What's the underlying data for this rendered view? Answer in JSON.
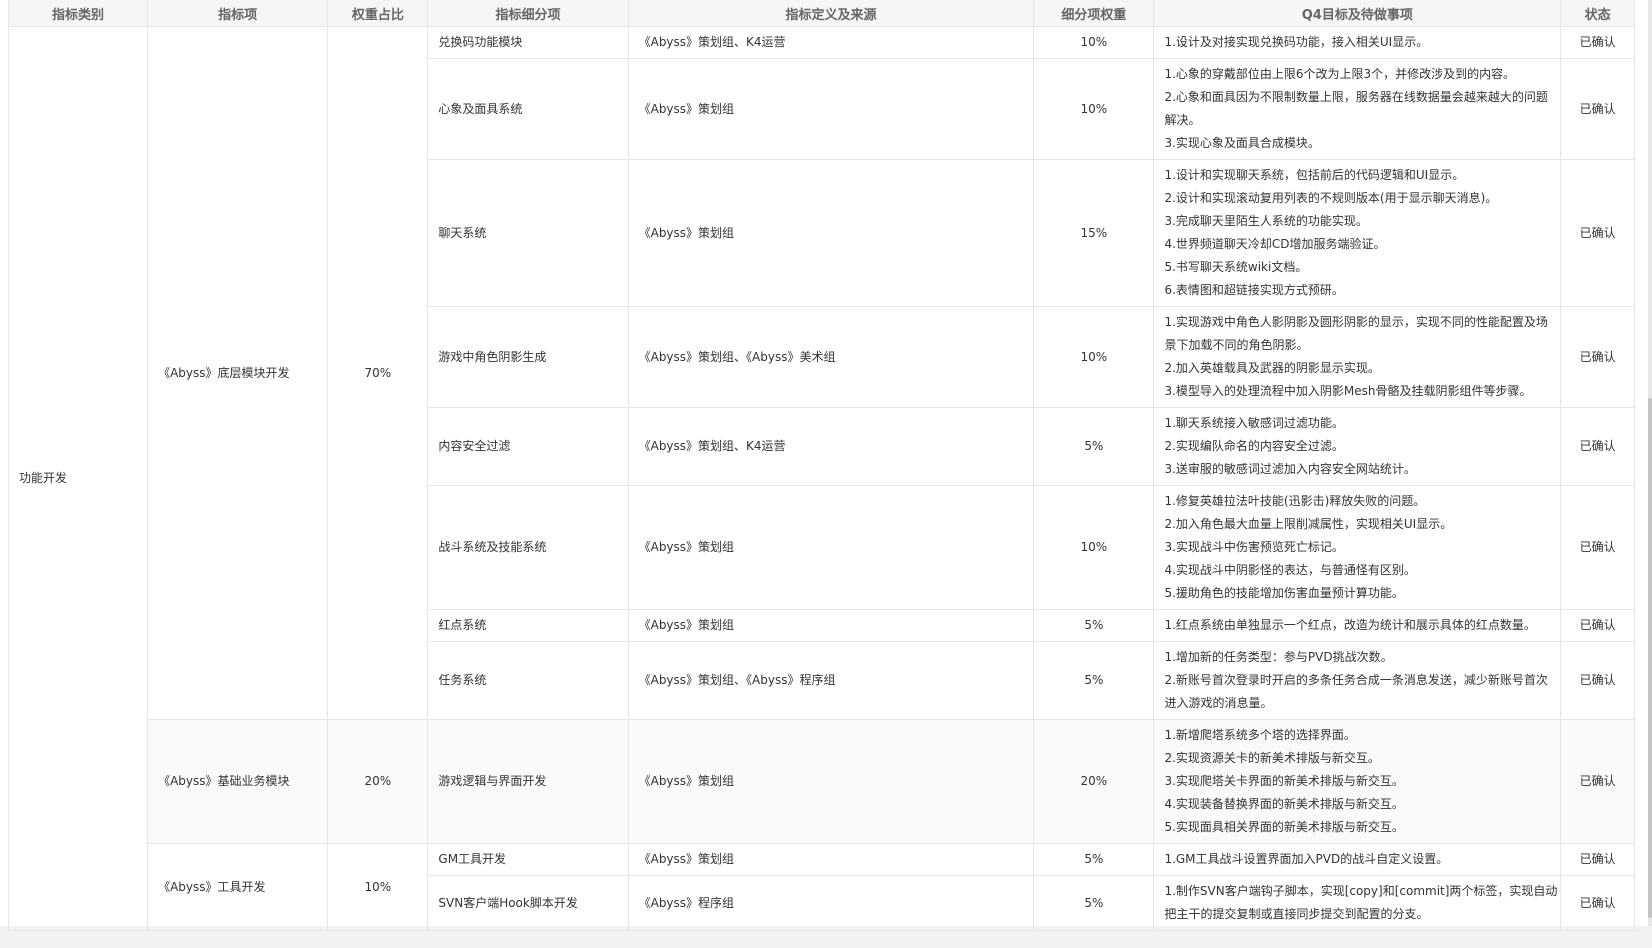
{
  "headers": [
    "指标类别",
    "指标项",
    "权重占比",
    "指标细分项",
    "指标定义及来源",
    "细分项权重",
    "Q4目标及待做事项",
    "状态"
  ],
  "category": "功能开发",
  "groups": [
    {
      "item": "《Abyss》底层模块开发",
      "weight": "70%",
      "rows": [
        {
          "sub": "兑换码功能模块",
          "source": "《Abyss》策划组、K4运营",
          "sub_weight": "10%",
          "goals": [
            "1.设计及对接实现兑换码功能，接入相关UI显示。"
          ],
          "status": "已确认"
        },
        {
          "sub": "心象及面具系统",
          "source": "《Abyss》策划组",
          "sub_weight": "10%",
          "goals": [
            "1.心象的穿戴部位由上限6个改为上限3个，并修改涉及到的内容。",
            "2.心象和面具因为不限制数量上限，服务器在线数据量会越来越大的问题",
            "解决。",
            "3.实现心象及面具合成模块。"
          ],
          "status": "已确认"
        },
        {
          "sub": "聊天系统",
          "source": "《Abyss》策划组",
          "sub_weight": "15%",
          "goals": [
            "1.设计和实现聊天系统，包括前后的代码逻辑和UI显示。",
            "2.设计和实现滚动复用列表的不规则版本(用于显示聊天消息)。",
            "3.完成聊天里陌生人系统的功能实现。",
            "4.世界频道聊天冷却CD增加服务端验证。",
            "5.书写聊天系统wiki文档。",
            "6.表情图和超链接实现方式预研。"
          ],
          "status": "已确认"
        },
        {
          "sub": "游戏中角色阴影生成",
          "source": "《Abyss》策划组、《Abyss》美术组",
          "sub_weight": "10%",
          "goals": [
            "1.实现游戏中角色人影阴影及圆形阴影的显示，实现不同的性能配置及场",
            "景下加载不同的角色阴影。",
            "2.加入英雄载具及武器的阴影显示实现。",
            "3.模型导入的处理流程中加入阴影Mesh骨骼及挂载阴影组件等步骤。"
          ],
          "status": "已确认"
        },
        {
          "sub": "内容安全过滤",
          "source": "《Abyss》策划组、K4运营",
          "sub_weight": "5%",
          "goals": [
            "1.聊天系统接入敏感词过滤功能。",
            "2.实现编队命名的内容安全过滤。",
            "3.送审服的敏感词过滤加入内容安全网站统计。"
          ],
          "status": "已确认"
        },
        {
          "sub": "战斗系统及技能系统",
          "source": "《Abyss》策划组",
          "sub_weight": "10%",
          "goals": [
            "1.修复英雄拉法叶技能(迅影击)释放失败的问题。",
            "2.加入角色最大血量上限削减属性，实现相关UI显示。",
            "3.实现战斗中伤害预览死亡标记。",
            "4.实现战斗中阴影怪的表达，与普通怪有区别。",
            "5.援助角色的技能增加伤害血量预计算功能。"
          ],
          "status": "已确认"
        },
        {
          "sub": "红点系统",
          "source": "《Abyss》策划组",
          "sub_weight": "5%",
          "goals": [
            "1.红点系统由单独显示一个红点，改造为统计和展示具体的红点数量。"
          ],
          "status": "已确认"
        },
        {
          "sub": "任务系统",
          "source": "《Abyss》策划组、《Abyss》程序组",
          "sub_weight": "5%",
          "goals": [
            "1.增加新的任务类型：参与PVD挑战次数。",
            "2.新账号首次登录时开启的多条任务合成一条消息发送，减少新账号首次",
            "进入游戏的消息量。"
          ],
          "status": "已确认"
        }
      ]
    },
    {
      "item": "《Abyss》基础业务模块",
      "weight": "20%",
      "rows": [
        {
          "sub": "游戏逻辑与界面开发",
          "source": "《Abyss》策划组",
          "sub_weight": "20%",
          "goals": [
            "1.新增爬塔系统多个塔的选择界面。",
            "2.实现资源关卡的新美术排版与新交互。",
            "3.实现爬塔关卡界面的新美术排版与新交互。",
            "4.实现装备替换界面的新美术排版与新交互。",
            "5.实现面具相关界面的新美术排版与新交互。"
          ],
          "status": "已确认"
        }
      ]
    },
    {
      "item": "《Abyss》工具开发",
      "weight": "10%",
      "rows": [
        {
          "sub": "GM工具开发",
          "source": "《Abyss》策划组",
          "sub_weight": "5%",
          "goals": [
            "1.GM工具战斗设置界面加入PVD的战斗自定义设置。"
          ],
          "status": "已确认"
        },
        {
          "sub": "SVN客户端Hook脚本开发",
          "source": "《Abyss》程序组",
          "sub_weight": "5%",
          "goals": [
            "1.制作SVN客户端钩子脚本，实现[copy]和[commit]两个标签，实现自动",
            "把主干的提交复制或直接同步提交到配置的分支。"
          ],
          "status": "已确认"
        }
      ]
    }
  ]
}
